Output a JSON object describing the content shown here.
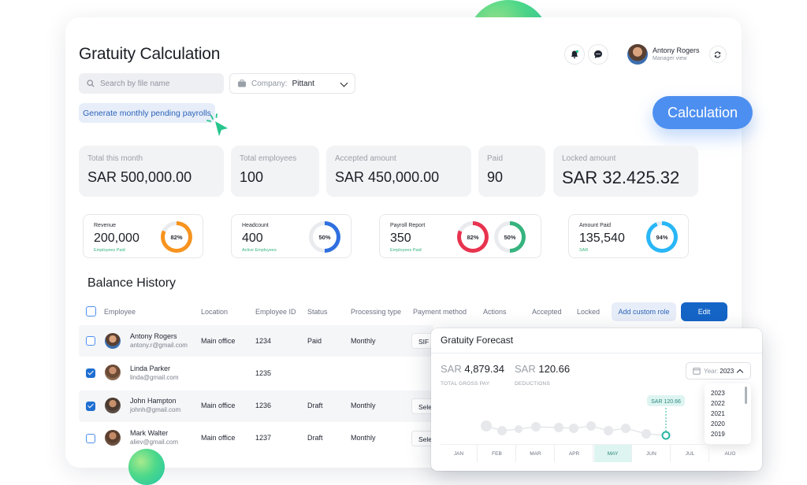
{
  "page": {
    "title": "Gratuity Calculation"
  },
  "search": {
    "placeholder": "Search by file name"
  },
  "company": {
    "label": "Company:",
    "value": "Pittant"
  },
  "actions": {
    "generate_label": "Generate monthly pending payrolls",
    "calculation_label": "Calculation"
  },
  "user": {
    "name": "Antony Rogers",
    "role": "Manager view"
  },
  "stats": [
    {
      "label": "Total this month",
      "value": "SAR 500,000.00"
    },
    {
      "label": "Total employees",
      "value": "100"
    },
    {
      "label": "Accepted amount",
      "value": "SAR 450,000.00"
    },
    {
      "label": "Paid",
      "value": "90"
    },
    {
      "label": "Locked amount",
      "value": "SAR 32.425.32"
    }
  ],
  "kpis": [
    {
      "label": "Revenue",
      "value": "200,000",
      "sub": "Employees Paid",
      "rings": [
        {
          "pct": 82,
          "text": "82%",
          "color": "#f7931e"
        }
      ]
    },
    {
      "label": "Headcount",
      "value": "400",
      "sub": "Active Employees",
      "rings": [
        {
          "pct": 50,
          "text": "50%",
          "color": "#2f6fe0"
        }
      ]
    },
    {
      "label": "Payroll Report",
      "value": "350",
      "sub": "Employees Paid",
      "rings": [
        {
          "pct": 82,
          "text": "82%",
          "color": "#e8334f"
        },
        {
          "pct": 50,
          "text": "50%",
          "color": "#36b37e"
        }
      ]
    },
    {
      "label": "Amount Paid",
      "value": "135,540",
      "sub": "SAR",
      "rings": [
        {
          "pct": 94,
          "text": "94%",
          "color": "#29b6f6"
        }
      ]
    }
  ],
  "balance": {
    "title": "Balance History",
    "columns": [
      "Employee",
      "Location",
      "Employee ID",
      "Status",
      "Processing type",
      "Payment method",
      "Actions",
      "Accepted",
      "Locked"
    ],
    "add_role_label": "Add custom role",
    "edit_label": "Edit",
    "rows": [
      {
        "name": "Antony Rogers",
        "email": "antony.r@gmail.com",
        "location": "Main office",
        "id": "1234",
        "status": "Paid",
        "type": "Monthly",
        "payment": "SIF",
        "checked": false
      },
      {
        "name": "Linda Parker",
        "email": "linda@gmail.com",
        "location": "",
        "id": "1235",
        "status": "",
        "type": "",
        "payment": "",
        "checked": true
      },
      {
        "name": "John Hampton",
        "email": "johnh@gmail.com",
        "location": "Main office",
        "id": "1236",
        "status": "Draft",
        "type": "Monthly",
        "payment": "Sele",
        "checked": true
      },
      {
        "name": "Mark Walter",
        "email": "aliev@gmail.com",
        "location": "Main office",
        "id": "1237",
        "status": "Draft",
        "type": "Monthly",
        "payment": "Sele",
        "checked": false
      }
    ]
  },
  "forecast": {
    "title": "Gratuity Forecast",
    "gross": {
      "currency": "SAR",
      "amount": "4,879.34",
      "label": "TOTAL GROSS PAY"
    },
    "deductions": {
      "currency": "SAR",
      "amount": "120.66",
      "label": "DEDUCTIONS"
    },
    "year_label": "Year:",
    "year_value": "2023",
    "year_options": [
      "2023",
      "2022",
      "2021",
      "2020",
      "2019"
    ],
    "tooltip": "SAR 120.66",
    "months": [
      "JAN",
      "FEB",
      "MAR",
      "APR",
      "MAY",
      "JUN",
      "JUL",
      "AUG"
    ],
    "selected_month": "MAY"
  },
  "colors": {
    "accent": "#1565c7",
    "calculation": "#4d8ff0",
    "chart_line": "#2bb5a3"
  }
}
